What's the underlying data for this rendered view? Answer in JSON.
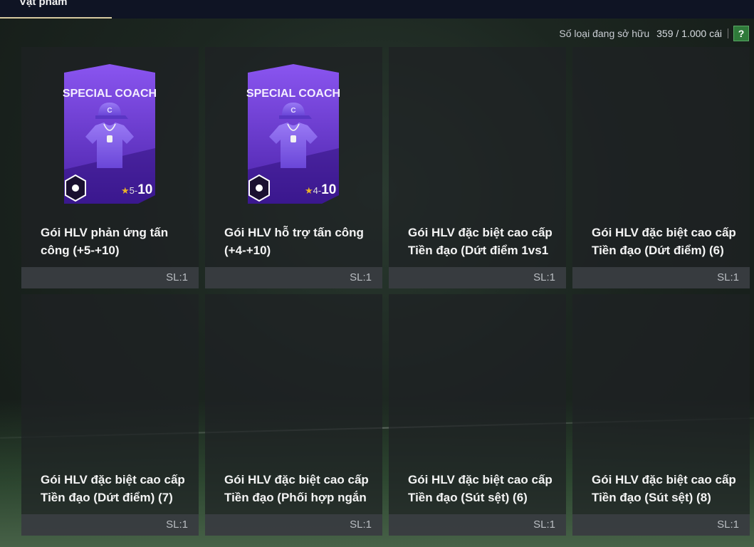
{
  "header": {
    "tab_label": "Vật phẩm"
  },
  "ownership": {
    "label": "Số loại đang sở hữu",
    "count": "359 / 1.000 cái",
    "help": "?"
  },
  "colors": {
    "accent": "#d6c9a0",
    "help_green": "#2f7a3a",
    "card_purple": "#6b3fd6"
  },
  "items": [
    {
      "name": "Gói HLV phản ứng tấn\ncông (+5-+10)",
      "qty": "SL:1",
      "has_art": true,
      "art": {
        "title": "SPECIAL COACH",
        "badge_icon": "running-player-icon",
        "min": "5-",
        "max": "10",
        "star": "★"
      }
    },
    {
      "name": "Gói HLV hỗ trợ tấn công\n(+4-+10)",
      "qty": "SL:1",
      "has_art": true,
      "art": {
        "title": "SPECIAL COACH",
        "badge_icon": "lock-house-icon",
        "min": "4-",
        "max": "10",
        "star": "★"
      }
    },
    {
      "name": "Gói HLV đặc biệt cao cấp\nTiền đạo (Dứt điểm 1vs1",
      "qty": "SL:1",
      "has_art": false
    },
    {
      "name": "Gói HLV đặc biệt cao cấp\nTiền đạo (Dứt điểm) (6)",
      "qty": "SL:1",
      "has_art": false
    },
    {
      "name": "Gói HLV đặc biệt cao cấp\nTiền đạo (Dứt điểm) (7)",
      "qty": "SL:1",
      "has_art": false
    },
    {
      "name": "Gói HLV đặc biệt cao cấp\nTiền đạo (Phối hợp ngắn",
      "qty": "SL:1",
      "has_art": false
    },
    {
      "name": "Gói HLV đặc biệt cao cấp\nTiền đạo (Sút sệt) (6)",
      "qty": "SL:1",
      "has_art": false
    },
    {
      "name": "Gói HLV đặc biệt cao cấp\nTiền đạo (Sút sệt) (8)",
      "qty": "SL:1",
      "has_art": false
    }
  ]
}
